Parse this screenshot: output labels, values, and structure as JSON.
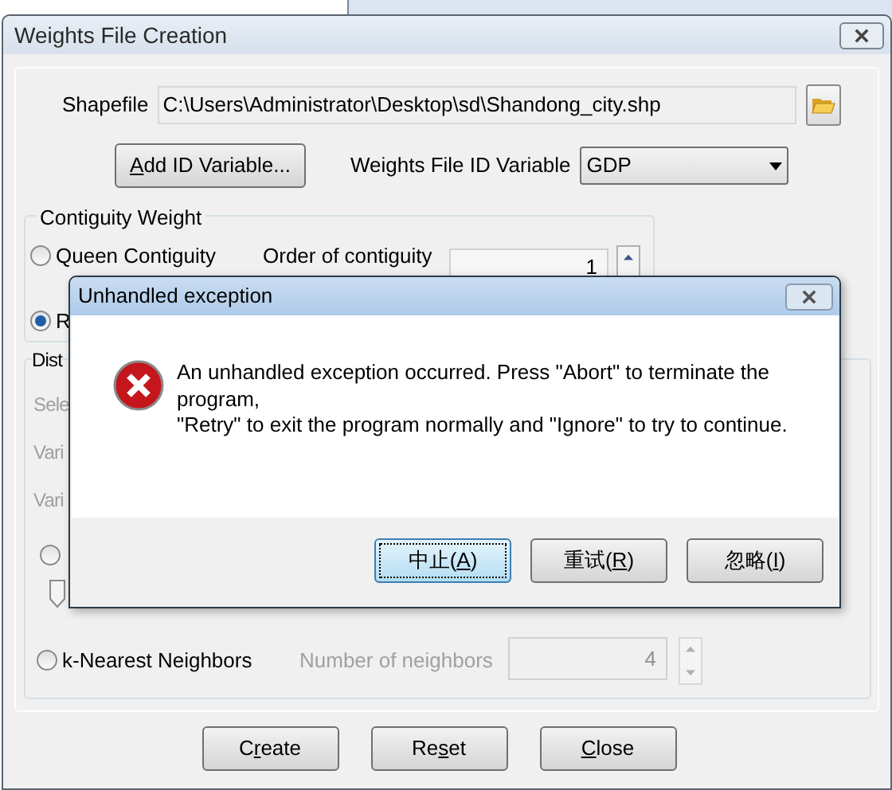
{
  "window": {
    "title": "Weights File Creation"
  },
  "shapefile": {
    "label": "Shapefile",
    "value": "C:\\Users\\Administrator\\Desktop\\sd\\Shandong_city.shp"
  },
  "add_id_button": {
    "key": "A",
    "after": "dd ID Variable..."
  },
  "id_variable": {
    "label": "Weights File ID Variable",
    "value": "GDP"
  },
  "contiguity": {
    "title": "Contiguity Weight",
    "order_label": "Order of contiguity",
    "order_value": "1",
    "options": [
      {
        "label": "Queen Contiguity",
        "selected": false
      },
      {
        "label": "R",
        "selected": true
      }
    ]
  },
  "distance": {
    "title": "Dist",
    "disabled": true,
    "fragments": [
      "Sele",
      "Vari",
      "Vari"
    ],
    "threshold": {
      "selected": false
    },
    "knn": {
      "label": "k-Nearest Neighbors",
      "selected": false,
      "disabled": true,
      "neighbors_label": "Number of neighbors",
      "neighbors_value": "4"
    }
  },
  "buttons": [
    {
      "before": "C",
      "key": "r",
      "after": "eate"
    },
    {
      "before": "Re",
      "key": "s",
      "after": "et"
    },
    {
      "key": "C",
      "after": "lose"
    }
  ],
  "dialog": {
    "title": "Unhandled exception",
    "message": "An unhandled exception occurred. Press \"Abort\" to terminate the program,\n\"Retry\" to exit the program normally and \"Ignore\" to try to continue.",
    "buttons": [
      {
        "before": "中止(",
        "key": "A",
        "after": ")",
        "selected": true
      },
      {
        "before": "重试(",
        "key": "R",
        "after": ")",
        "selected": false
      },
      {
        "before": "忽略(",
        "key": "I",
        "after": ")",
        "selected": false
      }
    ]
  }
}
